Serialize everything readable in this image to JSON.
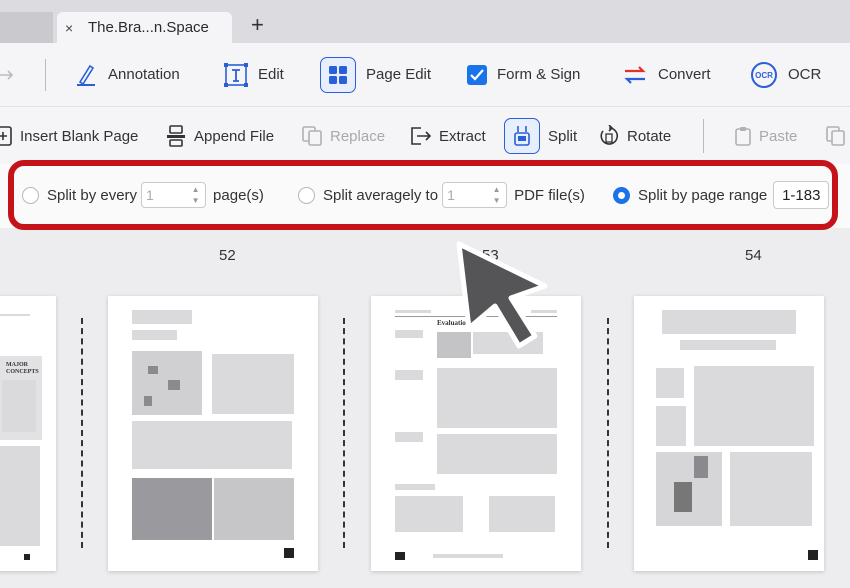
{
  "tabs": {
    "active_title": "The.Bra...n.Space",
    "close_glyph": "×",
    "add_glyph": "+"
  },
  "toolbar": {
    "annotation": "Annotation",
    "edit": "Edit",
    "page_edit": "Page Edit",
    "form_sign": "Form & Sign",
    "convert": "Convert",
    "ocr": "OCR"
  },
  "page_tools": {
    "insert_blank": "Insert Blank Page",
    "append_file": "Append File",
    "replace": "Replace",
    "extract": "Extract",
    "split": "Split",
    "rotate": "Rotate",
    "paste": "Paste"
  },
  "split_options": {
    "by_every_label": "Split by every",
    "by_every_value": "1",
    "by_every_unit": "page(s)",
    "averagely_label": "Split averagely to",
    "averagely_value": "1",
    "averagely_unit": "PDF file(s)",
    "by_range_label": "Split by page range",
    "range_value": "1-183",
    "selected": "by_range"
  },
  "pages": {
    "numbers": [
      "52",
      "53",
      "54"
    ],
    "p53_heading": "Evaluation",
    "p51_heading": "MAJOR CONCEPTS"
  },
  "colors": {
    "highlight_frame": "#c4141a",
    "accent_blue": "#1a73e8",
    "convert_red": "#e0322c"
  },
  "icons": [
    "arrow-icon",
    "annotation-pen-icon",
    "edit-text-icon",
    "page-edit-grid-icon",
    "checkbox-icon",
    "convert-arrows-icon",
    "ocr-icon",
    "insert-page-icon",
    "append-file-icon",
    "replace-icon",
    "extract-icon",
    "split-icon",
    "rotate-icon",
    "paste-icon",
    "copy-icon",
    "mouse-cursor-icon"
  ]
}
